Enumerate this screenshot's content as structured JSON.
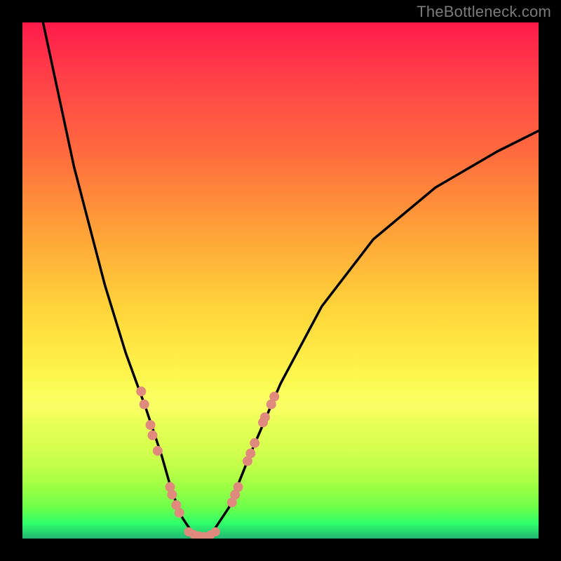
{
  "watermark": "TheBottleneck.com",
  "colors": {
    "frame": "#000000",
    "gradient_top": "#ff1a4a",
    "gradient_bottom": "#22b673",
    "curve": "#000000",
    "marker": "#e08a7d",
    "watermark_text": "#7a7a7a"
  },
  "chart_data": {
    "type": "line",
    "title": "",
    "xlabel": "",
    "ylabel": "",
    "xlim": [
      0,
      100
    ],
    "ylim": [
      0,
      100
    ],
    "grid": false,
    "curve_points": [
      {
        "x": 4,
        "y": 100
      },
      {
        "x": 10,
        "y": 72
      },
      {
        "x": 16,
        "y": 49
      },
      {
        "x": 20,
        "y": 36
      },
      {
        "x": 24,
        "y": 25
      },
      {
        "x": 27,
        "y": 16
      },
      {
        "x": 29,
        "y": 9
      },
      {
        "x": 31,
        "y": 4
      },
      {
        "x": 33,
        "y": 1
      },
      {
        "x": 35,
        "y": 0.3
      },
      {
        "x": 37,
        "y": 1.5
      },
      {
        "x": 40,
        "y": 6
      },
      {
        "x": 44,
        "y": 16
      },
      {
        "x": 50,
        "y": 30
      },
      {
        "x": 58,
        "y": 45
      },
      {
        "x": 68,
        "y": 58
      },
      {
        "x": 80,
        "y": 68
      },
      {
        "x": 92,
        "y": 75
      },
      {
        "x": 100,
        "y": 79
      }
    ],
    "markers_left_branch": [
      {
        "x": 23.0,
        "y": 28.5
      },
      {
        "x": 23.6,
        "y": 26.0
      },
      {
        "x": 24.8,
        "y": 22.0
      },
      {
        "x": 25.2,
        "y": 20.0
      },
      {
        "x": 26.2,
        "y": 17.0
      },
      {
        "x": 28.6,
        "y": 10.0
      },
      {
        "x": 29.0,
        "y": 8.5
      },
      {
        "x": 29.8,
        "y": 6.5
      },
      {
        "x": 30.4,
        "y": 5.0
      }
    ],
    "markers_bottom": [
      {
        "x": 32.2,
        "y": 1.3
      },
      {
        "x": 33.2,
        "y": 0.8
      },
      {
        "x": 34.2,
        "y": 0.5
      },
      {
        "x": 35.2,
        "y": 0.4
      },
      {
        "x": 36.4,
        "y": 0.7
      },
      {
        "x": 37.4,
        "y": 1.3
      }
    ],
    "markers_right_branch": [
      {
        "x": 40.6,
        "y": 7.0
      },
      {
        "x": 41.2,
        "y": 8.5
      },
      {
        "x": 41.8,
        "y": 10.0
      },
      {
        "x": 43.6,
        "y": 15.0
      },
      {
        "x": 44.2,
        "y": 16.5
      },
      {
        "x": 45.0,
        "y": 18.5
      },
      {
        "x": 46.6,
        "y": 22.5
      },
      {
        "x": 47.0,
        "y": 23.5
      },
      {
        "x": 48.2,
        "y": 26.0
      },
      {
        "x": 48.8,
        "y": 27.5
      }
    ]
  }
}
